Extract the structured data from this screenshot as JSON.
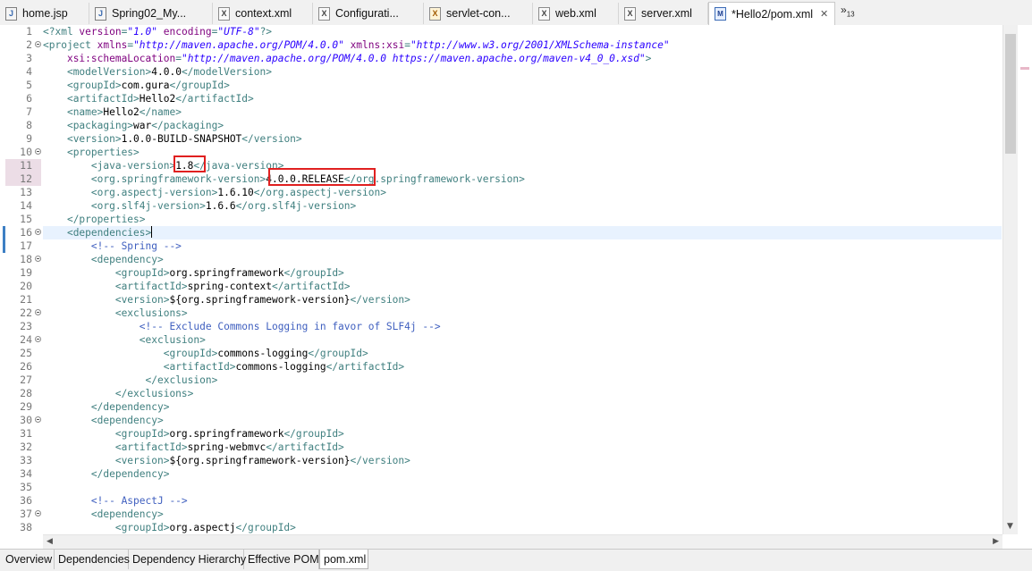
{
  "editor_tabs": [
    {
      "label": "home.jsp",
      "icon": "jsp-file-icon"
    },
    {
      "label": "Spring02_My...",
      "icon": "java-file-icon"
    },
    {
      "label": "context.xml",
      "icon": "xml-file-icon"
    },
    {
      "label": "Configurati...",
      "icon": "xml-file-icon"
    },
    {
      "label": "servlet-con...",
      "icon": "xml-warning-file-icon"
    },
    {
      "label": "web.xml",
      "icon": "xml-file-icon"
    },
    {
      "label": "server.xml",
      "icon": "xml-file-icon"
    },
    {
      "label": "*Hello2/pom.xml",
      "icon": "maven-pom-icon",
      "active": true
    }
  ],
  "tab_overflow": {
    "symbol": "»",
    "count": "13"
  },
  "bottom_tabs": [
    "Overview",
    "Dependencies",
    "Dependency Hierarchy",
    "Effective POM",
    "pom.xml"
  ],
  "active_bottom_tab": "pom.xml",
  "colors": {
    "tag": "#3f7f7f",
    "attribute": "#7f007f",
    "string": "#2a00ff",
    "comment": "#3f5fbf",
    "text": "#000000",
    "highlight_box": "#e02020",
    "current_line": "#e8f2fe",
    "changed_line": "#ecdde6"
  },
  "code_lines": [
    {
      "n": "1",
      "tokens": [
        [
          "tag",
          "<?xml "
        ],
        [
          "attr",
          "version"
        ],
        [
          "tag",
          "="
        ],
        [
          "str",
          "\"1.0\""
        ],
        [
          "tag",
          " "
        ],
        [
          "attr",
          "encoding"
        ],
        [
          "tag",
          "="
        ],
        [
          "str",
          "\"UTF-8\""
        ],
        [
          "tag",
          "?>"
        ]
      ]
    },
    {
      "n": "2",
      "fold": true,
      "tokens": [
        [
          "tag",
          "<project "
        ],
        [
          "attr",
          "xmlns"
        ],
        [
          "tag",
          "="
        ],
        [
          "str",
          "\"http://maven.apache.org/POM/4.0.0\""
        ],
        [
          "tag",
          " "
        ],
        [
          "attr",
          "xmlns:xsi"
        ],
        [
          "tag",
          "="
        ],
        [
          "str",
          "\"http://www.w3.org/2001/XMLSchema-instance\""
        ]
      ]
    },
    {
      "n": "3",
      "tokens": [
        [
          "txt",
          "    "
        ],
        [
          "attr",
          "xsi:schemaLocation"
        ],
        [
          "tag",
          "="
        ],
        [
          "str",
          "\"http://maven.apache.org/POM/4.0.0 https://maven.apache.org/maven-v4_0_0.xsd\""
        ],
        [
          "tag",
          ">"
        ]
      ]
    },
    {
      "n": "4",
      "tokens": [
        [
          "txt",
          "    "
        ],
        [
          "tag",
          "<modelVersion>"
        ],
        [
          "txt",
          "4.0.0"
        ],
        [
          "tag",
          "</modelVersion>"
        ]
      ]
    },
    {
      "n": "5",
      "tokens": [
        [
          "txt",
          "    "
        ],
        [
          "tag",
          "<groupId>"
        ],
        [
          "txt",
          "com.gura"
        ],
        [
          "tag",
          "</groupId>"
        ]
      ]
    },
    {
      "n": "6",
      "tokens": [
        [
          "txt",
          "    "
        ],
        [
          "tag",
          "<artifactId>"
        ],
        [
          "txt",
          "Hello2"
        ],
        [
          "tag",
          "</artifactId>"
        ]
      ]
    },
    {
      "n": "7",
      "tokens": [
        [
          "txt",
          "    "
        ],
        [
          "tag",
          "<name>"
        ],
        [
          "txt",
          "Hello2"
        ],
        [
          "tag",
          "</name>"
        ]
      ]
    },
    {
      "n": "8",
      "tokens": [
        [
          "txt",
          "    "
        ],
        [
          "tag",
          "<packaging>"
        ],
        [
          "txt",
          "war"
        ],
        [
          "tag",
          "</packaging>"
        ]
      ]
    },
    {
      "n": "9",
      "tokens": [
        [
          "txt",
          "    "
        ],
        [
          "tag",
          "<version>"
        ],
        [
          "txt",
          "1.0.0-BUILD-SNAPSHOT"
        ],
        [
          "tag",
          "</version>"
        ]
      ]
    },
    {
      "n": "10",
      "fold": true,
      "tokens": [
        [
          "txt",
          "    "
        ],
        [
          "tag",
          "<properties>"
        ]
      ]
    },
    {
      "n": "11",
      "changed": true,
      "tokens": [
        [
          "txt",
          "        "
        ],
        [
          "tag",
          "<java-version>"
        ],
        [
          "txt",
          "1.8"
        ],
        [
          "tag",
          "</java-version>"
        ]
      ]
    },
    {
      "n": "12",
      "changed": true,
      "tokens": [
        [
          "txt",
          "        "
        ],
        [
          "tag",
          "<org.springframework-version>"
        ],
        [
          "txt",
          "4.0.0.RELEASE"
        ],
        [
          "tag",
          "</org.springframework-version>"
        ]
      ]
    },
    {
      "n": "13",
      "tokens": [
        [
          "txt",
          "        "
        ],
        [
          "tag",
          "<org.aspectj-version>"
        ],
        [
          "txt",
          "1.6.10"
        ],
        [
          "tag",
          "</org.aspectj-version>"
        ]
      ]
    },
    {
      "n": "14",
      "tokens": [
        [
          "txt",
          "        "
        ],
        [
          "tag",
          "<org.slf4j-version>"
        ],
        [
          "txt",
          "1.6.6"
        ],
        [
          "tag",
          "</org.slf4j-version>"
        ]
      ]
    },
    {
      "n": "15",
      "tokens": [
        [
          "txt",
          "    "
        ],
        [
          "tag",
          "</properties>"
        ]
      ]
    },
    {
      "n": "16",
      "fold": true,
      "current": true,
      "tokens": [
        [
          "txt",
          "    "
        ],
        [
          "tag",
          "<dependencies>"
        ]
      ]
    },
    {
      "n": "17",
      "tokens": [
        [
          "txt",
          "        "
        ],
        [
          "com",
          "<!-- Spring -->"
        ]
      ]
    },
    {
      "n": "18",
      "fold": true,
      "tokens": [
        [
          "txt",
          "        "
        ],
        [
          "tag",
          "<dependency>"
        ]
      ]
    },
    {
      "n": "19",
      "tokens": [
        [
          "txt",
          "            "
        ],
        [
          "tag",
          "<groupId>"
        ],
        [
          "txt",
          "org.springframework"
        ],
        [
          "tag",
          "</groupId>"
        ]
      ]
    },
    {
      "n": "20",
      "tokens": [
        [
          "txt",
          "            "
        ],
        [
          "tag",
          "<artifactId>"
        ],
        [
          "txt",
          "spring-context"
        ],
        [
          "tag",
          "</artifactId>"
        ]
      ]
    },
    {
      "n": "21",
      "tokens": [
        [
          "txt",
          "            "
        ],
        [
          "tag",
          "<version>"
        ],
        [
          "txt",
          "${org.springframework-version}"
        ],
        [
          "tag",
          "</version>"
        ]
      ]
    },
    {
      "n": "22",
      "fold": true,
      "tokens": [
        [
          "txt",
          "            "
        ],
        [
          "tag",
          "<exclusions>"
        ]
      ]
    },
    {
      "n": "23",
      "tokens": [
        [
          "txt",
          "                "
        ],
        [
          "com",
          "<!-- Exclude Commons Logging in favor of SLF4j -->"
        ]
      ]
    },
    {
      "n": "24",
      "fold": true,
      "tokens": [
        [
          "txt",
          "                "
        ],
        [
          "tag",
          "<exclusion>"
        ]
      ]
    },
    {
      "n": "25",
      "tokens": [
        [
          "txt",
          "                    "
        ],
        [
          "tag",
          "<groupId>"
        ],
        [
          "txt",
          "commons-logging"
        ],
        [
          "tag",
          "</groupId>"
        ]
      ]
    },
    {
      "n": "26",
      "tokens": [
        [
          "txt",
          "                    "
        ],
        [
          "tag",
          "<artifactId>"
        ],
        [
          "txt",
          "commons-logging"
        ],
        [
          "tag",
          "</artifactId>"
        ]
      ]
    },
    {
      "n": "27",
      "tokens": [
        [
          "txt",
          "                 "
        ],
        [
          "tag",
          "</exclusion>"
        ]
      ]
    },
    {
      "n": "28",
      "tokens": [
        [
          "txt",
          "            "
        ],
        [
          "tag",
          "</exclusions>"
        ]
      ]
    },
    {
      "n": "29",
      "tokens": [
        [
          "txt",
          "        "
        ],
        [
          "tag",
          "</dependency>"
        ]
      ]
    },
    {
      "n": "30",
      "fold": true,
      "tokens": [
        [
          "txt",
          "        "
        ],
        [
          "tag",
          "<dependency>"
        ]
      ]
    },
    {
      "n": "31",
      "tokens": [
        [
          "txt",
          "            "
        ],
        [
          "tag",
          "<groupId>"
        ],
        [
          "txt",
          "org.springframework"
        ],
        [
          "tag",
          "</groupId>"
        ]
      ]
    },
    {
      "n": "32",
      "tokens": [
        [
          "txt",
          "            "
        ],
        [
          "tag",
          "<artifactId>"
        ],
        [
          "txt",
          "spring-webmvc"
        ],
        [
          "tag",
          "</artifactId>"
        ]
      ]
    },
    {
      "n": "33",
      "tokens": [
        [
          "txt",
          "            "
        ],
        [
          "tag",
          "<version>"
        ],
        [
          "txt",
          "${org.springframework-version}"
        ],
        [
          "tag",
          "</version>"
        ]
      ]
    },
    {
      "n": "34",
      "tokens": [
        [
          "txt",
          "        "
        ],
        [
          "tag",
          "</dependency>"
        ]
      ]
    },
    {
      "n": "35",
      "tokens": []
    },
    {
      "n": "36",
      "tokens": [
        [
          "txt",
          "        "
        ],
        [
          "com",
          "<!-- AspectJ -->"
        ]
      ]
    },
    {
      "n": "37",
      "fold": true,
      "tokens": [
        [
          "txt",
          "        "
        ],
        [
          "tag",
          "<dependency>"
        ]
      ]
    },
    {
      "n": "38",
      "tokens": [
        [
          "txt",
          "            "
        ],
        [
          "tag",
          "<groupId>"
        ],
        [
          "txt",
          "org.aspectj"
        ],
        [
          "tag",
          "</groupId>"
        ]
      ]
    }
  ]
}
